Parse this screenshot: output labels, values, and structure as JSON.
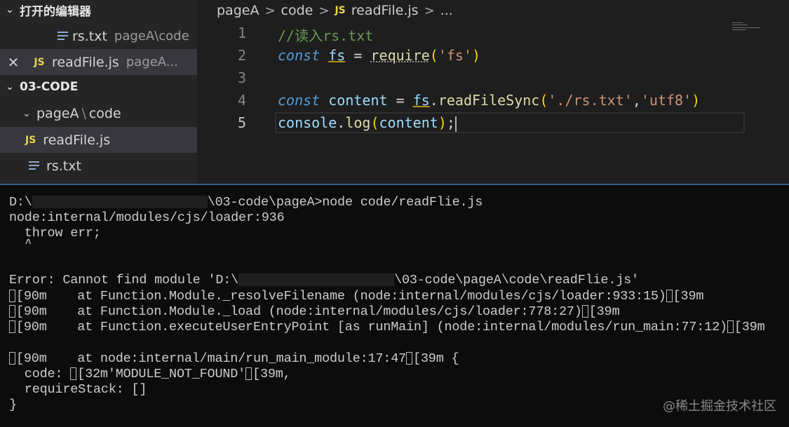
{
  "sidebar": {
    "open_editors_header": "打开的编辑器",
    "open_editors": [
      {
        "label": "rs.txt",
        "description": "pageA\\code",
        "icon": "text-file-icon"
      },
      {
        "label": "readFile.js",
        "description": "pageA...",
        "icon": "js-file-icon",
        "close_glyph": "✕"
      }
    ],
    "folder_header": "03-CODE",
    "tree": {
      "folder_name": "pageA",
      "folder_sep": "\\",
      "subfolder_name": "code",
      "items": [
        {
          "label": "readFile.js",
          "icon": "js-file-icon"
        },
        {
          "label": "rs.txt",
          "icon": "text-file-icon"
        }
      ]
    },
    "js_badge": "JS"
  },
  "breadcrumb": {
    "parts": [
      "pageA",
      "code",
      "readFile.js",
      "..."
    ],
    "separator": ">"
  },
  "editor": {
    "line_numbers": [
      "1",
      "2",
      "3",
      "4",
      "5"
    ],
    "active_line": "5"
  },
  "code": {
    "l1": "//读入rs.txt",
    "l2_kw": "const",
    "l2_var": "fs",
    "l2_eq": "=",
    "l2_fn": "require",
    "l2_p1": "(",
    "l2_str": "'fs'",
    "l2_p2": ")",
    "l4_kw": "const",
    "l4_var": "content",
    "l4_eq": "=",
    "l4_obj": "fs",
    "l4_dot": ".",
    "l4_fn": "readFileSync",
    "l4_p1": "(",
    "l4_s1": "'./rs.txt'",
    "l4_comma": ",",
    "l4_s2": "'utf8'",
    "l4_p2": ")",
    "l5_obj": "console",
    "l5_dot": ".",
    "l5_fn": "log",
    "l5_p1": "(",
    "l5_arg": "content",
    "l5_p2": ")",
    "l5_semi": ";"
  },
  "terminal": {
    "prompt_start": "D:\\",
    "prompt_end": "\\03-code\\pageA>node code/readFlie.js",
    "line2": "node:internal/modules/cjs/loader:936",
    "line3": "  throw err;",
    "line4": "  ^",
    "err_start": "Error: Cannot find module 'D:\\",
    "err_end": "\\03-code\\pageA\\code\\readFlie.js'",
    "st1": "[90m    at Function.Module._resolveFilename (node:internal/modules/cjs/loader:933:15)",
    "st1_end": "[39m",
    "st2": "[90m    at Function.Module._load (node:internal/modules/cjs/loader:778:27)",
    "st2_end": "[39m",
    "st3": "[90m    at Function.executeUserEntryPoint [as runMain] (node:internal/modules/run_main:77:12)",
    "st3_end": "[39m",
    "st4": "[90m    at node:internal/main/run_main_module:17:47",
    "st4_end": "[39m {",
    "code_pre": "  code: ",
    "code_mid": "[32m'MODULE_NOT_FOUND'",
    "code_end": "[39m,",
    "require_stack": "  requireStack: []",
    "closing": "}"
  },
  "watermark": "@稀土掘金技术社区"
}
